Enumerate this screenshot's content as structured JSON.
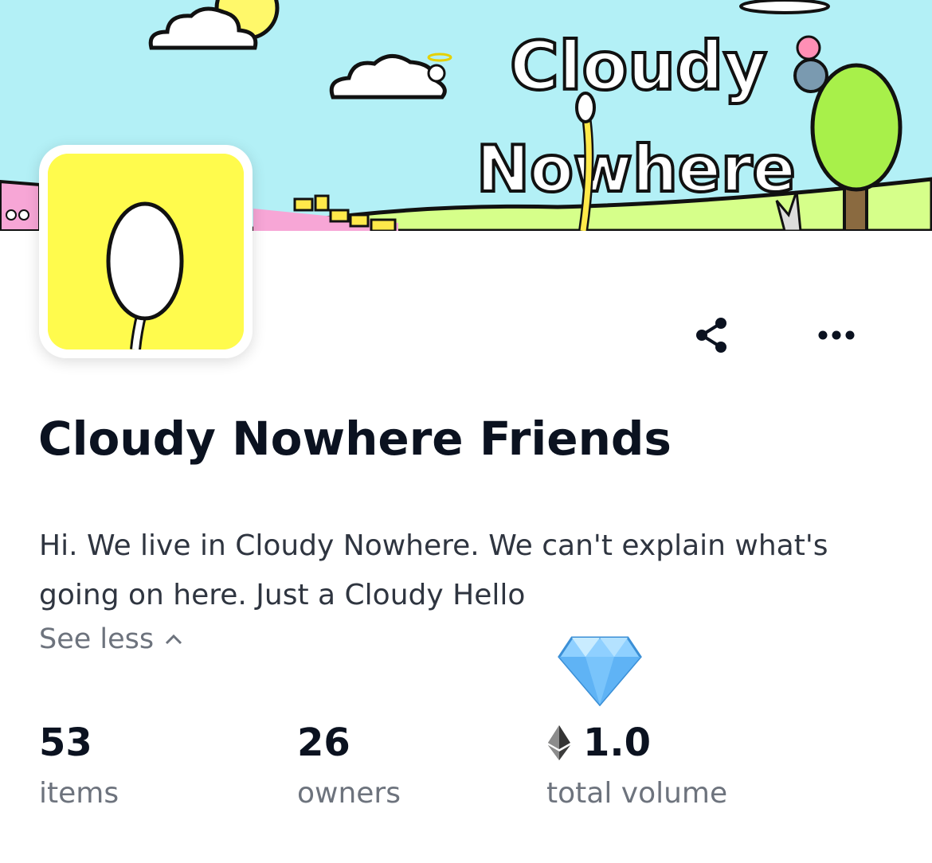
{
  "banner": {
    "title_line1": "Cloudy",
    "title_line2": "Nowhere"
  },
  "collection": {
    "name": "Cloudy Nowhere Friends",
    "description": "Hi. We live in Cloudy Nowhere. We can't explain what's going on here. Just a Cloudy Hello",
    "see_less_label": "See less"
  },
  "actions": {
    "share_icon": "share-icon",
    "more_icon": "more-horizontal-icon"
  },
  "stats": {
    "items": {
      "value": "53",
      "label": "items"
    },
    "owners": {
      "value": "26",
      "label": "owners"
    },
    "volume": {
      "value": "1.0",
      "label": "total volume",
      "currency_icon": "ethereum-icon"
    }
  },
  "badge": {
    "icon": "diamond-icon"
  },
  "colors": {
    "sky": "#b3f0f6",
    "grass": "#d6ff8a",
    "pink_ground": "#f7a6d6",
    "avatar_bg": "#fffb4d",
    "title_text": "#0b1220",
    "body_text": "#2f3540",
    "muted_text": "#6d737d"
  }
}
